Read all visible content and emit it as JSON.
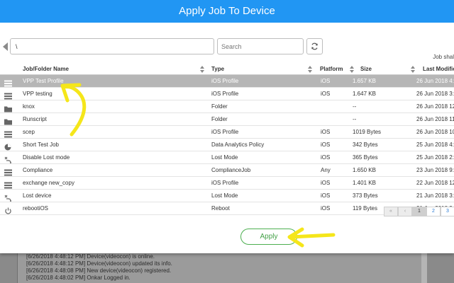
{
  "modal": {
    "title": "Apply Job To Device"
  },
  "toolbar": {
    "path_value": "\\",
    "search_placeholder": "Search",
    "job_shared_label": "Job shal"
  },
  "table": {
    "columns": [
      "Job/Folder Name",
      "Type",
      "Platform",
      "Size",
      "Last Modified"
    ],
    "rows": [
      {
        "icon": "job-list-icon",
        "name": "VPP Test Profile",
        "type": "iOS Profile",
        "platform": "iOS",
        "size": "1.657 KB",
        "modified": "26 Jun 2018 4:"
      },
      {
        "icon": "job-list-icon",
        "name": "VPP testing",
        "type": "iOS Profile",
        "platform": "iOS",
        "size": "1.647 KB",
        "modified": "26 Jun 2018 3:"
      },
      {
        "icon": "folder-icon",
        "name": "knox",
        "type": "Folder",
        "platform": "",
        "size": "--",
        "modified": "26 Jun 2018 12:"
      },
      {
        "icon": "folder-icon",
        "name": "Runscript",
        "type": "Folder",
        "platform": "",
        "size": "--",
        "modified": "26 Jun 2018 11:"
      },
      {
        "icon": "job-list-icon",
        "name": "scep",
        "type": "iOS Profile",
        "platform": "iOS",
        "size": "1019 Bytes",
        "modified": "26 Jun 2018 10:"
      },
      {
        "icon": "pie-chart-icon",
        "name": "Short Test Job",
        "type": "Data Analytics Policy",
        "platform": "iOS",
        "size": "342 Bytes",
        "modified": "25 Jun 2018 4:"
      },
      {
        "icon": "lost-mode-icon",
        "name": "Disable Lost mode",
        "type": "Lost Mode",
        "platform": "iOS",
        "size": "365 Bytes",
        "modified": "25 Jun 2018 2:"
      },
      {
        "icon": "job-list-icon",
        "name": "Compliance",
        "type": "ComplianceJob",
        "platform": "Any",
        "size": "1.650 KB",
        "modified": "23 Jun 2018 9:"
      },
      {
        "icon": "job-list-icon",
        "name": "exchange new_copy",
        "type": "iOS Profile",
        "platform": "iOS",
        "size": "1.401 KB",
        "modified": "22 Jun 2018 12:"
      },
      {
        "icon": "lost-mode-icon",
        "name": "Lost device",
        "type": "Lost Mode",
        "platform": "iOS",
        "size": "373 Bytes",
        "modified": "21 Jun 2018 3:"
      },
      {
        "icon": "power-icon",
        "name": "rebootiOS",
        "type": "Reboot",
        "platform": "iOS",
        "size": "119 Bytes",
        "modified": "21 Jun 2018 3:"
      }
    ]
  },
  "pagination": {
    "first": "«",
    "prev": "‹",
    "pages": [
      "1",
      "2",
      "3"
    ],
    "current": "1"
  },
  "apply_label": "Apply",
  "log": [
    "[6/26/2018 4:48:12 PM] Device(videocon) is online.",
    "[6/26/2018 4:48:12 PM] Device(videocon) updated its info.",
    "[6/26/2018 4:48:08 PM] New device(videocon) registered.",
    "[6/26/2018 4:48:02 PM] Onkar Logged in."
  ],
  "colors": {
    "header": "#2196f3",
    "apply_border": "#4caf50",
    "annotation": "#f5e61a",
    "selected_row": "#b6b6b6"
  }
}
